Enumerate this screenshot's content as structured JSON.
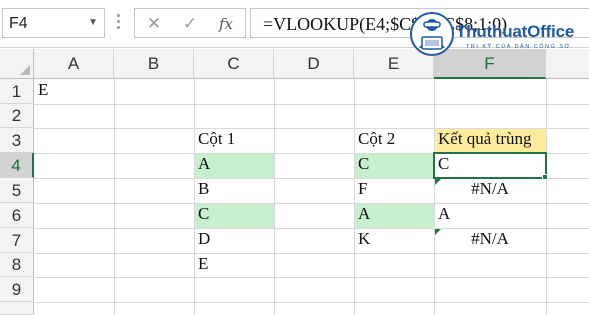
{
  "formula_bar": {
    "name_box": "F4",
    "cancel_icon": "✕",
    "enter_icon": "✓",
    "fx_label": "fx",
    "formula": "=VLOOKUP(E4;$C$4:$C$8;1;0)"
  },
  "logo": {
    "name": "ThuthuatOffice",
    "tagline": "TRI KỸ CỦA DÂN CÔNG SỞ"
  },
  "grid": {
    "columns": [
      "A",
      "B",
      "C",
      "D",
      "E",
      "F"
    ],
    "rows": [
      "1",
      "2",
      "3",
      "4",
      "5",
      "6",
      "7",
      "8",
      "9"
    ],
    "selected_column": "F",
    "selected_row": "4",
    "cells": {
      "A1": "E",
      "C3": "Cột 1",
      "E3": "Cột 2",
      "F3": "Kết quả trùng",
      "C4": "A",
      "C5": "B",
      "C6": "C",
      "C7": "D",
      "C8": "E",
      "E4": "C",
      "E5": "F",
      "E6": "A",
      "E7": "K",
      "F4": "C",
      "F5": "#N/A",
      "F6": "A",
      "F7": "#N/A"
    }
  },
  "colors": {
    "duplicate_highlight": "#c6efce",
    "header_highlight": "#ffeb9c",
    "selection": "#217346"
  }
}
